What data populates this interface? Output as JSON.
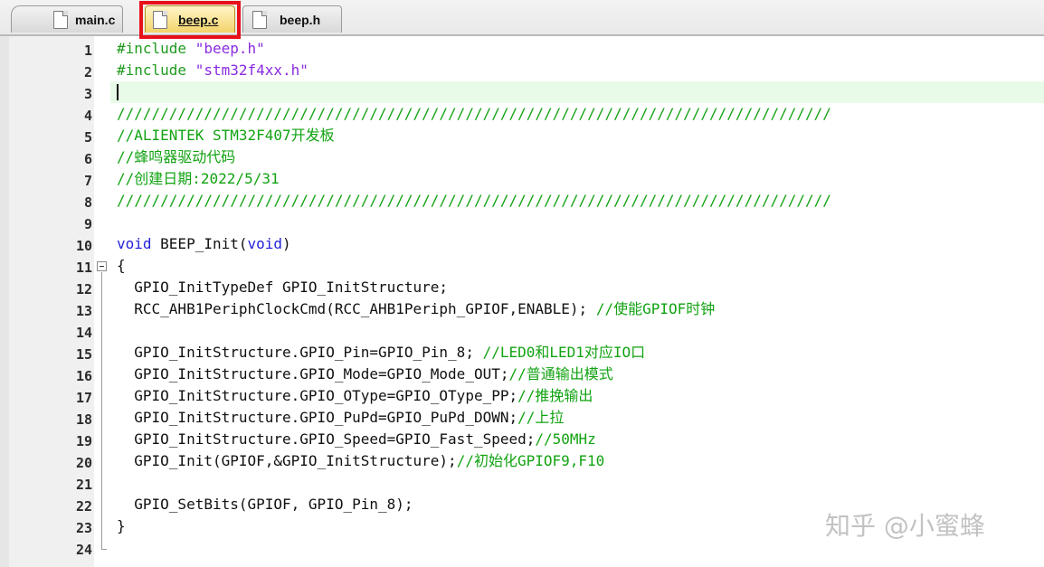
{
  "tabs": [
    {
      "label": "main.c",
      "active": false
    },
    {
      "label": "beep.c",
      "active": true
    },
    {
      "label": "beep.h",
      "active": false
    }
  ],
  "editor": {
    "current_line": 3,
    "lines": [
      {
        "n": "1",
        "text": "#include \"beep.h\""
      },
      {
        "n": "2",
        "text": "#include \"stm32f4xx.h\""
      },
      {
        "n": "3",
        "text": ""
      },
      {
        "n": "4",
        "text": "//////////////////////////////////////////////////////////////////////////////////"
      },
      {
        "n": "5",
        "text": "//ALIENTEK STM32F407开发板"
      },
      {
        "n": "6",
        "text": "//蜂鸣器驱动代码"
      },
      {
        "n": "7",
        "text": "//创建日期:2022/5/31"
      },
      {
        "n": "8",
        "text": "//////////////////////////////////////////////////////////////////////////////////"
      },
      {
        "n": "9",
        "text": ""
      },
      {
        "n": "10",
        "text": "void BEEP_Init(void)"
      },
      {
        "n": "11",
        "text": "{"
      },
      {
        "n": "12",
        "text": "  GPIO_InitTypeDef GPIO_InitStructure;"
      },
      {
        "n": "13",
        "text": "  RCC_AHB1PeriphClockCmd(RCC_AHB1Periph_GPIOF,ENABLE); //使能GPIOF时钟"
      },
      {
        "n": "14",
        "text": ""
      },
      {
        "n": "15",
        "text": "  GPIO_InitStructure.GPIO_Pin=GPIO_Pin_8; //LED0和LED1对应IO口"
      },
      {
        "n": "16",
        "text": "  GPIO_InitStructure.GPIO_Mode=GPIO_Mode_OUT;//普通输出模式"
      },
      {
        "n": "17",
        "text": "  GPIO_InitStructure.GPIO_OType=GPIO_OType_PP;//推挽输出"
      },
      {
        "n": "18",
        "text": "  GPIO_InitStructure.GPIO_PuPd=GPIO_PuPd_DOWN;//上拉"
      },
      {
        "n": "19",
        "text": "  GPIO_InitStructure.GPIO_Speed=GPIO_Fast_Speed;//50MHz"
      },
      {
        "n": "20",
        "text": "  GPIO_Init(GPIOF,&GPIO_InitStructure);//初始化GPIOF9,F10"
      },
      {
        "n": "21",
        "text": ""
      },
      {
        "n": "22",
        "text": "  GPIO_SetBits(GPIOF, GPIO_Pin_8);"
      },
      {
        "n": "23",
        "text": "}"
      },
      {
        "n": "24",
        "text": ""
      }
    ]
  },
  "watermark": "知乎 @小蜜蜂",
  "colors": {
    "highlight_box": "#e8101a",
    "comment": "#12a312",
    "keyword": "#2323d8",
    "string": "#8a2be2",
    "current_line_bg": "#e8fbe8"
  }
}
